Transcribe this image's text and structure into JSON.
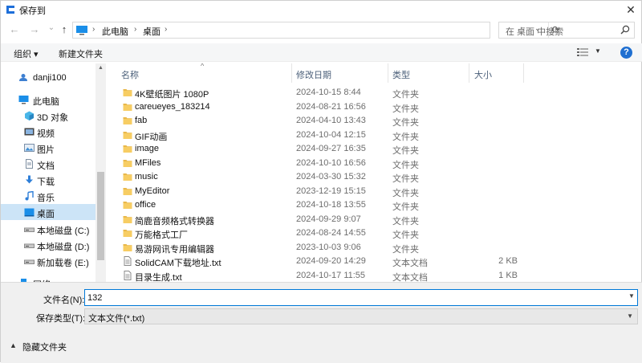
{
  "window": {
    "title": "保存到"
  },
  "nav": {
    "back": "←",
    "forward": "→",
    "recent": "⌄",
    "up": "↑",
    "breadcrumb": [
      "此电脑",
      "桌面"
    ],
    "search_placeholder": "在 桌面 中搜索"
  },
  "toolbar": {
    "organize": "组织 ▾",
    "new_folder": "新建文件夹",
    "help": "?"
  },
  "sidebar": {
    "items": [
      {
        "label": "danji100",
        "icon": "user-cloud-icon"
      },
      {
        "label": "此电脑",
        "icon": "computer-icon"
      },
      {
        "label": "3D 对象",
        "icon": "3d-objects-icon"
      },
      {
        "label": "视频",
        "icon": "video-icon"
      },
      {
        "label": "图片",
        "icon": "pictures-icon"
      },
      {
        "label": "文档",
        "icon": "documents-icon"
      },
      {
        "label": "下载",
        "icon": "download-icon"
      },
      {
        "label": "音乐",
        "icon": "music-icon"
      },
      {
        "label": "桌面",
        "icon": "desktop-icon",
        "selected": true
      },
      {
        "label": "本地磁盘 (C:)",
        "icon": "drive-icon"
      },
      {
        "label": "本地磁盘 (D:)",
        "icon": "drive-icon"
      },
      {
        "label": "新加载卷 (E:)",
        "icon": "drive-icon"
      },
      {
        "label": "网络",
        "icon": "network-icon"
      }
    ]
  },
  "columns": {
    "name": "名称",
    "modified": "修改日期",
    "type": "类型",
    "size": "大小"
  },
  "files": [
    {
      "name": "4K壁纸图片 1080P",
      "modified": "2024-10-15 8:44",
      "type": "文件夹",
      "size": "",
      "kind": "folder"
    },
    {
      "name": "careueyes_183214",
      "modified": "2024-08-21 16:56",
      "type": "文件夹",
      "size": "",
      "kind": "folder"
    },
    {
      "name": "fab",
      "modified": "2024-04-10 13:43",
      "type": "文件夹",
      "size": "",
      "kind": "folder"
    },
    {
      "name": "GIF动画",
      "modified": "2024-10-04 12:15",
      "type": "文件夹",
      "size": "",
      "kind": "folder"
    },
    {
      "name": "image",
      "modified": "2024-09-27 16:35",
      "type": "文件夹",
      "size": "",
      "kind": "folder"
    },
    {
      "name": "MFiles",
      "modified": "2024-10-10 16:56",
      "type": "文件夹",
      "size": "",
      "kind": "folder"
    },
    {
      "name": "music",
      "modified": "2024-03-30 15:32",
      "type": "文件夹",
      "size": "",
      "kind": "folder"
    },
    {
      "name": "MyEditor",
      "modified": "2023-12-19 15:15",
      "type": "文件夹",
      "size": "",
      "kind": "folder"
    },
    {
      "name": "office",
      "modified": "2024-10-18 13:55",
      "type": "文件夹",
      "size": "",
      "kind": "folder"
    },
    {
      "name": "简鹿音频格式转换器",
      "modified": "2024-09-29 9:07",
      "type": "文件夹",
      "size": "",
      "kind": "folder"
    },
    {
      "name": "万能格式工厂",
      "modified": "2024-08-24 14:55",
      "type": "文件夹",
      "size": "",
      "kind": "folder"
    },
    {
      "name": "易游网讯专用编辑器",
      "modified": "2023-10-03 9:06",
      "type": "文件夹",
      "size": "",
      "kind": "folder"
    },
    {
      "name": "SolidCAM下载地址.txt",
      "modified": "2024-09-20 14:29",
      "type": "文本文档",
      "size": "2 KB",
      "kind": "text"
    },
    {
      "name": "目录生成.txt",
      "modified": "2024-10-17 11:55",
      "type": "文本文档",
      "size": "1 KB",
      "kind": "text"
    }
  ],
  "form": {
    "filename_label": "文件名(N):",
    "filename_value": "132",
    "filetype_label": "保存类型(T):",
    "filetype_value": "文本文件(*.txt)"
  },
  "footer": {
    "hide_folders": "隐藏文件夹"
  },
  "colors": {
    "accent": "#0078d7",
    "folder": "#f5c65b",
    "selected_bg": "#cce4f7",
    "help": "#1f6fd1"
  }
}
